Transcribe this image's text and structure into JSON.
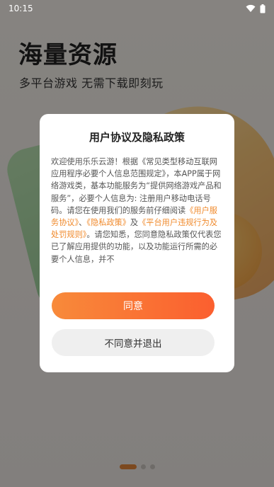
{
  "status_bar": {
    "time": "10:15"
  },
  "hero": {
    "title": "海量资源",
    "subtitle": "多平台游戏  无需下载即刻玩"
  },
  "dialog": {
    "title": "用户协议及隐私政策",
    "body_intro": "欢迎使用乐乐云游！根据《常见类型移动互联网应用程序必要个人信息范围规定》，本APP属于网络游戏类，基本功能服务为“提供网络游戏产品和服务”，必要个人信息为: 注册用户移动电话号码。请您在使用我们的服务前仔细阅读",
    "link_service": "《用户服务协议》",
    "sep1": "、",
    "link_privacy": "《隐私政策》",
    "sep2": "及",
    "link_rules": "《平台用户违规行为及处罚规则》",
    "body_rest": "。请您知悉，您同意隐私政策仅代表您已了解应用提供的功能，以及功能运行所需的必要个人信息，并不",
    "agree_label": "同意",
    "decline_label": "不同意并退出"
  },
  "pager": {
    "count": 3,
    "active_index": 0
  },
  "colors": {
    "accent": "#f08a2c",
    "button_gradient_start": "#f88a3a",
    "button_gradient_end": "#fb5f2f",
    "overlay": "rgba(0,0,0,0.45)"
  }
}
